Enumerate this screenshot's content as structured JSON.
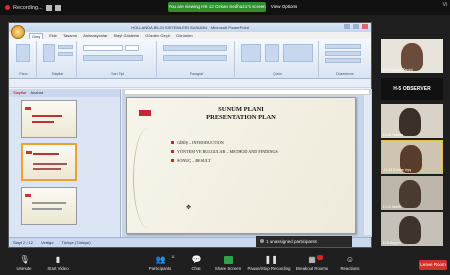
{
  "topbar": {
    "recording_label": "Recording...",
    "share_banner": "You are viewing HS 12 Ozkan Sedhaziz's screen",
    "view_options": "View Options",
    "corner_label": "Vi"
  },
  "ppt": {
    "window_title": "HOLLANDA BİLGİ SİSTEMLERİ SUNUMU · Microsoft PowerPoint",
    "tabs": [
      "Giriş",
      "Ekle",
      "Tasarım",
      "Animasyonlar",
      "Slayt Gösterisi",
      "Gözden Geçir",
      "Görünüm"
    ],
    "groups": [
      "Pano",
      "Slaytlar",
      "Yazı Tipi",
      "Paragraf",
      "Çizim",
      "Düzenleme"
    ],
    "pane_tabs": [
      "Slaytlar",
      "Anahat"
    ],
    "status": [
      "Slayt 2 / 12",
      "Vertigo",
      "Türkçe (Türkiye)"
    ]
  },
  "slide": {
    "title_line1": "SUNUM PLANI",
    "title_line2": "PRESENTATION PLAN",
    "bullets": [
      "GİRİŞ – INTRODUCTION",
      "YÖNTEM VE BULGULAR – METHOD AND FINDINGS",
      "SONUÇ – RESULT"
    ]
  },
  "overlay": {
    "unassigned": "1 unassigned participants"
  },
  "gallery": {
    "tiles": [
      {
        "name": "H-5 Gurgül Özgül"
      },
      {
        "label": "H-5 OBSERVER"
      },
      {
        "name": "H-12 Hasan"
      },
      {
        "name": "H-12 Emine Ayş"
      },
      {
        "name": "H-11 Melih"
      },
      {
        "name": "H-5 Akgün"
      }
    ]
  },
  "toolbar": {
    "unmute": "Unmute",
    "start_video": "Start Video",
    "participants": "Participants",
    "participants_count": "11",
    "chat": "Chat",
    "share_screen": "Share Screen",
    "pause_share": "Pause/Stop Recording",
    "breakout": "Breakout Rooms",
    "reactions": "Reactions",
    "leave": "Leave Room"
  },
  "colors": {
    "accent_green": "#2f8f2f",
    "leave_red": "#d2312c",
    "slide_accent": "#c22233"
  }
}
